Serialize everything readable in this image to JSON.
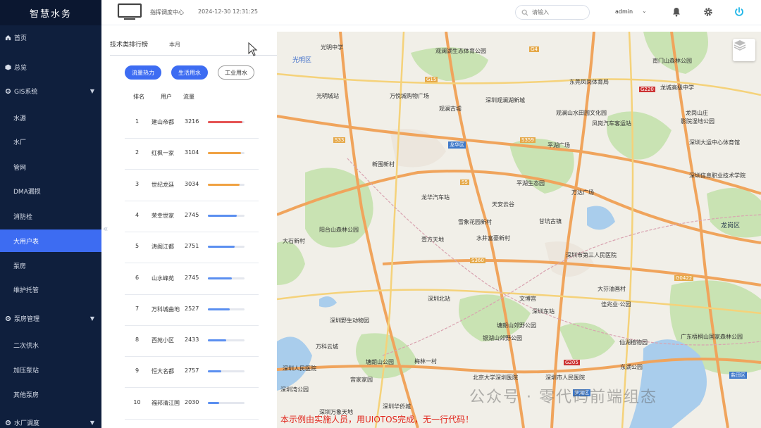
{
  "app": {
    "logo": "智慧水务"
  },
  "sidebar": {
    "items": [
      {
        "label": "首页",
        "icon": "home-icon"
      },
      {
        "label": "总览",
        "icon": "cube-icon"
      },
      {
        "label": "GIS系统",
        "icon": "gear-icon"
      },
      {
        "label": "水源"
      },
      {
        "label": "水厂"
      },
      {
        "label": "管网"
      },
      {
        "label": "DMA漏损"
      },
      {
        "label": "消防栓"
      },
      {
        "label": "大用户表"
      },
      {
        "label": "泵房"
      },
      {
        "label": "维护托管"
      },
      {
        "label": "泵房管理",
        "icon": "gear-icon"
      },
      {
        "label": "二次供水"
      },
      {
        "label": "加压泵站"
      },
      {
        "label": "其他泵房"
      },
      {
        "label": "水厂调度",
        "icon": "gear-icon"
      }
    ]
  },
  "header": {
    "center_title": "指挥调度中心",
    "timestamp": "2024-12-30 12:31:25",
    "search_placeholder": "请输入",
    "user": "admin"
  },
  "panel": {
    "title": "技术类排行榜",
    "period": "本月",
    "tabs": [
      "流量热力",
      "生活用水",
      "工业用水"
    ],
    "columns": [
      "排名",
      "用户",
      "流量"
    ],
    "rows": [
      {
        "rank": "1",
        "user": "建山帝都",
        "flow": "3216",
        "fill": 0.94,
        "color": "#e55353"
      },
      {
        "rank": "2",
        "user": "红枫一家",
        "flow": "3104",
        "fill": 0.9,
        "color": "#f0a243"
      },
      {
        "rank": "3",
        "user": "世纪龙廷",
        "flow": "3034",
        "fill": 0.86,
        "color": "#f0a243"
      },
      {
        "rank": "4",
        "user": "荣幸世家",
        "flow": "2745",
        "fill": 0.78,
        "color": "#5b8ff0"
      },
      {
        "rank": "5",
        "user": "涛阁江都",
        "flow": "2751",
        "fill": 0.74,
        "color": "#5b8ff0"
      },
      {
        "rank": "6",
        "user": "山水峰苑",
        "flow": "2745",
        "fill": 0.66,
        "color": "#5b8ff0"
      },
      {
        "rank": "7",
        "user": "万科城曲地",
        "flow": "2527",
        "fill": 0.6,
        "color": "#5b8ff0"
      },
      {
        "rank": "8",
        "user": "西苑小区",
        "flow": "2433",
        "fill": 0.5,
        "color": "#5b8ff0"
      },
      {
        "rank": "9",
        "user": "恒大名都",
        "flow": "2757",
        "fill": 0.36,
        "color": "#5b8ff0"
      },
      {
        "rank": "10",
        "user": "福邦清江国",
        "flow": "2030",
        "fill": 0.3,
        "color": "#5b8ff0"
      }
    ]
  },
  "map": {
    "labels": [
      {
        "text": "光明中学"
      },
      {
        "text": "光明区"
      },
      {
        "text": "光明城站"
      },
      {
        "text": "万悦城购物广场"
      },
      {
        "text": "观澜湖生态体育公园"
      },
      {
        "text": "观澜古墟"
      },
      {
        "text": "深圳观澜湖新城"
      },
      {
        "text": "观澜山水田园文化园"
      },
      {
        "text": "东莞凤岗体育局"
      },
      {
        "text": "南门山森林公园"
      },
      {
        "text": "龙城高级中学"
      },
      {
        "text": "龙岗山庄"
      },
      {
        "text": "影院湿地公园"
      },
      {
        "text": "凤岗汽车客运站"
      },
      {
        "text": "龙华区"
      },
      {
        "text": "平湖广场"
      },
      {
        "text": "新围新村"
      },
      {
        "text": "平湖生态园"
      },
      {
        "text": "深圳大运中心体育馆"
      },
      {
        "text": "深圳信息职业技术学院"
      },
      {
        "text": "龙华汽车站"
      },
      {
        "text": "天安云谷"
      },
      {
        "text": "万达广场"
      },
      {
        "text": "阳台山森林公园"
      },
      {
        "text": "雪象花园新村"
      },
      {
        "text": "水井富豪新村"
      },
      {
        "text": "甘坑古镇"
      },
      {
        "text": "壹方天地"
      },
      {
        "text": "大石新村"
      },
      {
        "text": "龙岗区"
      },
      {
        "text": "深圳市第三人民医院"
      },
      {
        "text": "塘朗山郊野公园"
      },
      {
        "text": "大芬油画村"
      },
      {
        "text": "深圳北站"
      },
      {
        "text": "佳兆业·公园"
      },
      {
        "text": "文博宫"
      },
      {
        "text": "深圳东站"
      },
      {
        "text": "深圳野生动物园"
      },
      {
        "text": "银湖山郊野公园"
      },
      {
        "text": "万科云城"
      },
      {
        "text": "广东梧桐山国家森林公园"
      },
      {
        "text": "仙湖植物园"
      },
      {
        "text": "塘朗山公园"
      },
      {
        "text": "梅林一村"
      },
      {
        "text": "北京大学深圳医院"
      },
      {
        "text": "深圳市人民医院"
      },
      {
        "text": "东湖公园"
      },
      {
        "text": "深圳人民医院"
      },
      {
        "text": "宫家家园"
      },
      {
        "text": "深圳湾公园"
      },
      {
        "text": "罗湖区"
      },
      {
        "text": "盐田区"
      },
      {
        "text": "深圳万象天地"
      },
      {
        "text": "深圳华侨城"
      }
    ],
    "roads": [
      "G4",
      "G15",
      "S33",
      "S359",
      "G220",
      "S5",
      "S360",
      "G205",
      "G0422"
    ],
    "notice": "本示例由实施人员，用UIOTOS完成，无一行代码！",
    "watermark": "公众号 · 零代码前端组态"
  }
}
